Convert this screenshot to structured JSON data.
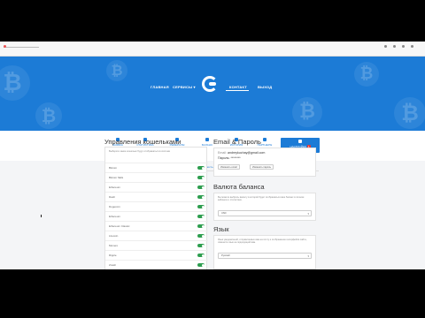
{
  "colors": {
    "brand": "#1c7bd6",
    "toggle_on": "#2e9e4f",
    "badge": "#e53935"
  },
  "hero": {
    "nav": [
      {
        "label": "ГЛАВНАЯ"
      },
      {
        "label": "СЕРВИСЫ ▾"
      },
      {
        "label": "КОНТАКТ"
      },
      {
        "label": "ВЫХОД"
      }
    ],
    "logo_icon": "coin-logo-icon",
    "coin_glyph": "₿"
  },
  "tabs": [
    {
      "label": "ЗАЯВКА",
      "icon": "request-icon"
    },
    {
      "label": "СТАТИСТИКА",
      "icon": "chart-icon"
    },
    {
      "label": "РЕФЕРАЛЫ",
      "icon": "users-icon"
    },
    {
      "label": "БАЛАНС",
      "icon": "wallet-icon"
    },
    {
      "label": "ИСТОРИЯ",
      "icon": "history-icon"
    },
    {
      "label": "ПАРТНЕРЫ",
      "icon": "partners-icon"
    },
    {
      "label": "НАСТРОЙКИ",
      "icon": "gear-icon",
      "badge": "1"
    }
  ],
  "subtabs": [
    {
      "label": "Общие"
    },
    {
      "label": "Безопасность",
      "badge": "!"
    },
    {
      "label": "Уведомления"
    }
  ],
  "wallets": {
    "title": "Управления кошельками",
    "description": "Выберите какие кошельки будут отображаться в системе",
    "items": [
      {
        "name": "Bitcoin",
        "enabled": true
      },
      {
        "name": "Bitcoin SEG",
        "enabled": true
      },
      {
        "name": "Ethereum",
        "enabled": true
      },
      {
        "name": "Dash",
        "enabled": true
      },
      {
        "name": "Dogecoin",
        "enabled": true
      },
      {
        "name": "Ethereum",
        "enabled": true
      },
      {
        "name": "Ethereum Classic",
        "enabled": true
      },
      {
        "name": "Litecoin",
        "enabled": true
      },
      {
        "name": "Monero",
        "enabled": true
      },
      {
        "name": "Ripple",
        "enabled": true
      },
      {
        "name": "Zcash",
        "enabled": true
      }
    ]
  },
  "email_password": {
    "title": "Email & Пароль",
    "email_label": "Email:",
    "email_value": "andreykuchay@gmail.com",
    "password_label": "Пароль:",
    "password_value": "********",
    "change_email": "Изменить email",
    "change_password": "Изменить пароль"
  },
  "currency": {
    "title": "Валюта баланса",
    "description": "Вы можете выбрать валюту в которой будет отображаться ваш баланс в личном кабинете и статистике.",
    "selected": "USD"
  },
  "language": {
    "title": "Язык",
    "description": "Язык уведомлений, отправляемых вам на почту и отображение интерфейса сайта, измените язык на подходящий вам.",
    "selected": "Русский"
  }
}
